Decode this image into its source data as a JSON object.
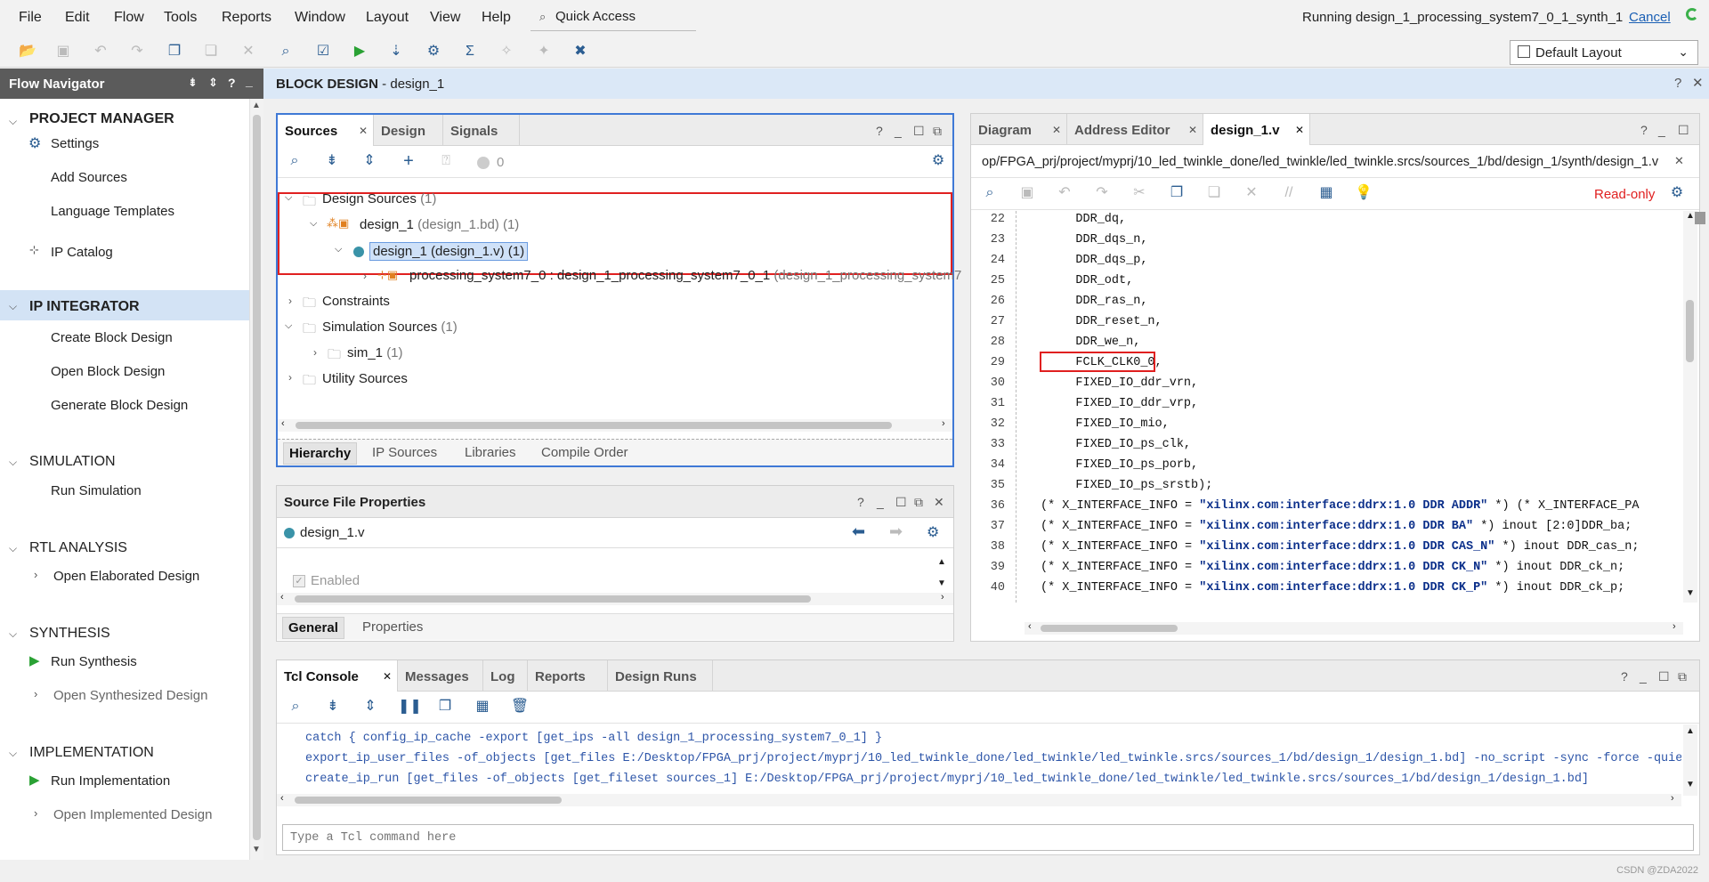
{
  "menu": [
    "File",
    "Edit",
    "Flow",
    "Tools",
    "Reports",
    "Window",
    "Layout",
    "View",
    "Help"
  ],
  "quick_access": "Quick Access",
  "run_status": "Running design_1_processing_system7_0_1_synth_1",
  "cancel": "Cancel",
  "layout": "Default Layout",
  "flow_navigator": {
    "title": "Flow Navigator",
    "sections": [
      {
        "label": "PROJECT MANAGER",
        "items": [
          "Settings",
          "Add Sources",
          "Language Templates",
          "IP Catalog"
        ]
      },
      {
        "label": "IP INTEGRATOR",
        "items": [
          "Create Block Design",
          "Open Block Design",
          "Generate Block Design"
        ]
      },
      {
        "label": "SIMULATION",
        "items": [
          "Run Simulation"
        ]
      },
      {
        "label": "RTL ANALYSIS",
        "items": [
          "Open Elaborated Design"
        ]
      },
      {
        "label": "SYNTHESIS",
        "items": [
          "Run Synthesis",
          "Open Synthesized Design"
        ]
      },
      {
        "label": "IMPLEMENTATION",
        "items": [
          "Run Implementation",
          "Open Implemented Design"
        ]
      }
    ]
  },
  "block_design": {
    "prefix": "BLOCK DESIGN",
    "name": " - design_1"
  },
  "sources": {
    "tabs": [
      "Sources",
      "Design",
      "Signals"
    ],
    "count": "0",
    "tree": {
      "design_sources": "Design Sources",
      "design_sources_count": "(1)",
      "bd": "design_1",
      "bd_detail": "(design_1.bd) (1)",
      "v": "design_1 (design_1.v) (1)",
      "ps_inst": "processing_system7_0 : design_1_processing_system7_0_1",
      "ps_detail": "(design_1_processing_system7",
      "constraints": "Constraints",
      "sim_sources": "Simulation Sources",
      "sim_sources_count": "(1)",
      "sim_1": "sim_1",
      "sim_1_count": "(1)",
      "utility": "Utility Sources"
    },
    "bottom_tabs": [
      "Hierarchy",
      "IP Sources",
      "Libraries",
      "Compile Order"
    ]
  },
  "sfp": {
    "title": "Source File Properties",
    "file": "design_1.v",
    "enabled": "Enabled",
    "tabs": [
      "General",
      "Properties"
    ]
  },
  "editor": {
    "tabs": [
      "Diagram",
      "Address Editor",
      "design_1.v"
    ],
    "path": "op/FPGA_prj/project/myprj/10_led_twinkle_done/led_twinkle/led_twinkle.srcs/sources_1/bd/design_1/synth/design_1.v",
    "readonly": "Read-only",
    "lines": [
      {
        "n": "22",
        "t": "    DDR_dq,"
      },
      {
        "n": "23",
        "t": "    DDR_dqs_n,"
      },
      {
        "n": "24",
        "t": "    DDR_dqs_p,"
      },
      {
        "n": "25",
        "t": "    DDR_odt,"
      },
      {
        "n": "26",
        "t": "    DDR_ras_n,"
      },
      {
        "n": "27",
        "t": "    DDR_reset_n,"
      },
      {
        "n": "28",
        "t": "    DDR_we_n,"
      },
      {
        "n": "29",
        "t": "    FCLK_CLK0_0,"
      },
      {
        "n": "30",
        "t": "    FIXED_IO_ddr_vrn,"
      },
      {
        "n": "31",
        "t": "    FIXED_IO_ddr_vrp,"
      },
      {
        "n": "32",
        "t": "    FIXED_IO_mio,"
      },
      {
        "n": "33",
        "t": "    FIXED_IO_ps_clk,"
      },
      {
        "n": "34",
        "t": "    FIXED_IO_ps_porb,"
      },
      {
        "n": "35",
        "t": "    FIXED_IO_ps_srstb);"
      }
    ],
    "attr_lines": [
      {
        "n": "36",
        "a": "(* X_INTERFACE_INFO = ",
        "s": "\"xilinx.com:interface:ddrx:1.0 DDR ADDR\"",
        "b": " *) (* X_INTERFACE_PA"
      },
      {
        "n": "37",
        "a": "(* X_INTERFACE_INFO = ",
        "s": "\"xilinx.com:interface:ddrx:1.0 DDR BA\"",
        "b": " *) inout [2:0]DDR_ba;"
      },
      {
        "n": "38",
        "a": "(* X_INTERFACE_INFO = ",
        "s": "\"xilinx.com:interface:ddrx:1.0 DDR CAS_N\"",
        "b": " *) inout DDR_cas_n;"
      },
      {
        "n": "39",
        "a": "(* X_INTERFACE_INFO = ",
        "s": "\"xilinx.com:interface:ddrx:1.0 DDR CK_N\"",
        "b": " *) inout DDR_ck_n;"
      },
      {
        "n": "40",
        "a": "(* X_INTERFACE_INFO = ",
        "s": "\"xilinx.com:interface:ddrx:1.0 DDR CK_P\"",
        "b": " *) inout DDR_ck_p;"
      }
    ]
  },
  "tcl": {
    "tabs": [
      "Tcl Console",
      "Messages",
      "Log",
      "Reports",
      "Design Runs"
    ],
    "lines": [
      "catch { config_ip_cache -export [get_ips -all design_1_processing_system7_0_1] }",
      "export_ip_user_files -of_objects [get_files E:/Desktop/FPGA_prj/project/myprj/10_led_twinkle_done/led_twinkle/led_twinkle.srcs/sources_1/bd/design_1/design_1.bd] -no_script -sync -force -quie",
      "create_ip_run [get_files -of_objects [get_fileset sources_1] E:/Desktop/FPGA_prj/project/myprj/10_led_twinkle_done/led_twinkle/led_twinkle.srcs/sources_1/bd/design_1/design_1.bd]"
    ],
    "placeholder": "Type a Tcl command here"
  },
  "watermark": "CSDN @ZDA2022"
}
